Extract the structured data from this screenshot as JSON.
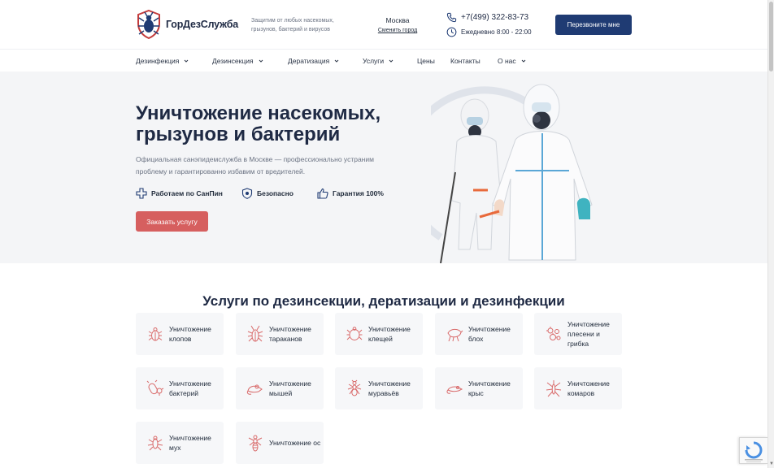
{
  "header": {
    "logo_text": "ГорДезСлужба",
    "tagline": "Защитим от любых насекомых, грызунов, бактерий и вирусов",
    "city": "Москва",
    "change_city": "Сменить город",
    "phone": "+7(499) 322-83-73",
    "hours": "Ежедневно 8:00 - 22:00",
    "callback_button": "Перезвоните мне",
    "icons": {
      "phone": "phone-icon",
      "clock": "clock-icon",
      "logo": "bug-shield-logo"
    }
  },
  "nav": {
    "items": [
      {
        "label": "Дезинфекция",
        "dropdown": true
      },
      {
        "label": "Дезинсекция",
        "dropdown": true
      },
      {
        "label": "Дератизация",
        "dropdown": true
      },
      {
        "label": "Услуги",
        "dropdown": true
      },
      {
        "label": "Цены",
        "dropdown": false
      },
      {
        "label": "Контакты",
        "dropdown": false
      },
      {
        "label": "О нас",
        "dropdown": true
      }
    ]
  },
  "hero": {
    "title_line1": "Уничтожение насекомых,",
    "title_line2": "грызунов и бактерий",
    "description": "Официальная санэпидемслужба в Москве — профессионально устраним проблему и гарантированно избавим от вредителей.",
    "features": [
      {
        "icon": "plus-cross-icon",
        "label": "Работаем по СанПин"
      },
      {
        "icon": "shield-icon",
        "label": "Безопасно"
      },
      {
        "icon": "thumbs-up-icon",
        "label": "Гарантия 100%"
      }
    ],
    "order_button": "Заказать услугу"
  },
  "services": {
    "title_strong": "Услуги",
    "title_rest": " по дезинсекции, дератизации и дезинфекции",
    "cards": [
      {
        "label": "Уничтожение клопов",
        "icon": "bedbug-icon"
      },
      {
        "label": "Уничтожение тараканов",
        "icon": "cockroach-icon"
      },
      {
        "label": "Уничтожение клещей",
        "icon": "tick-icon"
      },
      {
        "label": "Уничтожение блох",
        "icon": "flea-icon"
      },
      {
        "label": "Уничтожение плесени и грибка",
        "icon": "mold-icon"
      },
      {
        "label": "Уничтожение бактерий",
        "icon": "bacteria-icon"
      },
      {
        "label": "Уничтожение мышей",
        "icon": "mouse-icon"
      },
      {
        "label": "Уничтожение муравьёв",
        "icon": "ant-icon"
      },
      {
        "label": "Уничтожение крыс",
        "icon": "rat-icon"
      },
      {
        "label": "Уничтожение комаров",
        "icon": "mosquito-icon"
      },
      {
        "label": "Уничтожение мух",
        "icon": "fly-icon"
      },
      {
        "label": "Уничтожение ос",
        "icon": "wasp-icon"
      }
    ]
  },
  "colors": {
    "brand_navy": "#1f3b73",
    "accent_red": "#d65f5f",
    "icon_red": "#d96b6b",
    "hero_bg": "#f4f5f7",
    "card_bg": "#f6f7f9"
  }
}
